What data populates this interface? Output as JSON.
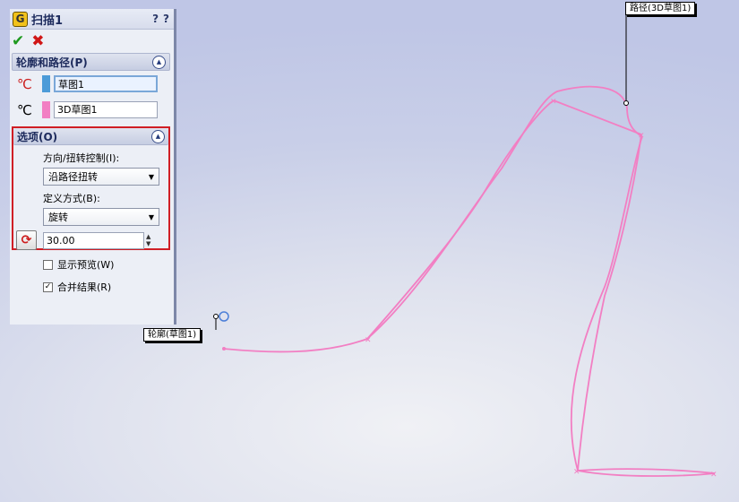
{
  "panel": {
    "title": "扫描1",
    "help_icon": "?",
    "feature_icon": "sweep-icon",
    "ok_icon": "check-icon",
    "cancel_icon": "close-icon"
  },
  "profile_path": {
    "header": "轮廓和路径(P)",
    "profile_value": "草图1",
    "path_value": "3D草图1",
    "profile_color": "#4c9bd8",
    "path_color": "#f27fc3"
  },
  "options": {
    "header": "选项(O)",
    "orientation_label": "方向/扭转控制(I):",
    "orientation_value": "沿路径扭转",
    "define_label": "定义方式(B):",
    "define_value": "旋转",
    "angle_value": "30.00"
  },
  "checks": {
    "show_preview_label": "显示预览(W)",
    "show_preview_checked": false,
    "merge_result_label": "合并结果(R)",
    "merge_result_checked": true
  },
  "callouts": {
    "path_label": "路径(3D草图1)",
    "profile_label": "轮廓(草图1)"
  },
  "colors": {
    "accent_red": "#d01e25",
    "sketch_pink": "#f27fc3",
    "panel_bg": "#eceff6"
  }
}
